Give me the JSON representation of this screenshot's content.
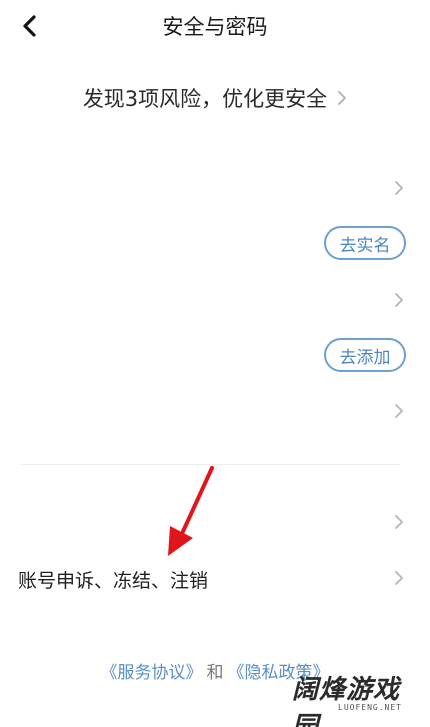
{
  "header": {
    "title": "安全与密码"
  },
  "risk_banner": {
    "text": "发现3项风险，优化更安全"
  },
  "rows": {
    "realname_button": "去实名",
    "add_button": "去添加",
    "appeal_label": "账号申诉、冻结、注销"
  },
  "footer": {
    "service_link": "《服务协议》",
    "and_text": "和",
    "privacy_link": "《隐私政策》"
  },
  "watermark": {
    "title": "阔烽游戏园",
    "subtitle": "LUOFENG.NET"
  },
  "colors": {
    "accent": "#4f86c0",
    "pill_border": "#6f9fcf",
    "arrow": "#e0141b"
  }
}
